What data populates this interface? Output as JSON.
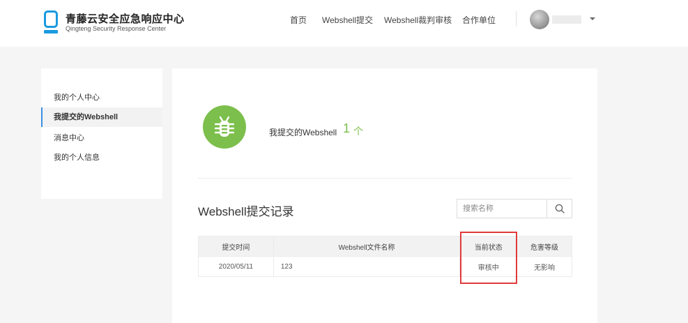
{
  "brand": {
    "title": "青藤云安全应急响应中心",
    "subtitle": "Qingteng Security Response Center",
    "color": "#1a9be0"
  },
  "nav": {
    "items": [
      "首页",
      "Webshell提交",
      "Webshell裁判审核",
      "合作单位"
    ]
  },
  "sidebar": {
    "items": [
      "我的个人中心",
      "我提交的Webshell",
      "消息中心",
      "我的个人信息"
    ],
    "active_index": 1
  },
  "summary": {
    "label": "我提交的Webshell",
    "count": "1",
    "unit": "个",
    "icon": "bug-icon",
    "accent": "#7cbf4c"
  },
  "records": {
    "title": "Webshell提交记录",
    "search_placeholder": "搜索名称",
    "columns": [
      "提交时间",
      "Webshell文件名称",
      "当前状态",
      "危害等级"
    ],
    "rows": [
      {
        "time": "2020/05/11",
        "name": "123",
        "status": "审核中",
        "level": "无影响"
      }
    ]
  },
  "annotation": {
    "color": "#e03a3a"
  }
}
